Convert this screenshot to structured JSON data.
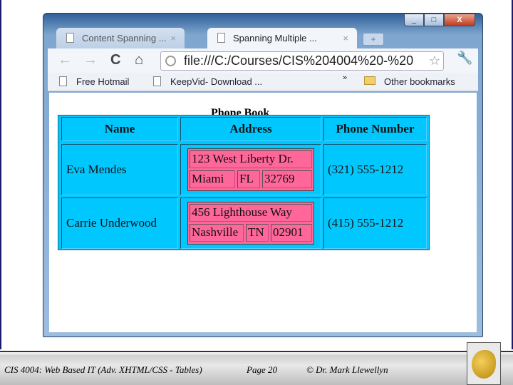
{
  "browser": {
    "tabs": [
      {
        "label": "Content Spanning ..."
      },
      {
        "label": "Spanning Multiple ..."
      }
    ],
    "address": "file:///C:/Courses/CIS%204004%20-%20",
    "bookmarks": [
      "Free Hotmail",
      "KeepVid- Download ..."
    ],
    "overflow": "»",
    "other_bookmarks": "Other bookmarks"
  },
  "table": {
    "caption": "Phone Book",
    "headers": [
      "Name",
      "Address",
      "Phone Number"
    ],
    "rows": [
      {
        "name": "Eva Mendes",
        "street": "123 West Liberty Dr.",
        "city": "Miami",
        "state": "FL",
        "zip": "32769",
        "phone": "(321) 555-1212"
      },
      {
        "name": "Carrie Underwood",
        "street": "456 Lighthouse Way",
        "city": "Nashville",
        "state": "TN",
        "zip": "02901",
        "phone": "(415) 555-1212"
      }
    ],
    "colors": {
      "table_bg": "#00c8ff",
      "address_bg": "#ff6699"
    }
  },
  "footer": {
    "course": "CIS 4004: Web Based IT (Adv. XHTML/CSS - Tables)",
    "page": "Page 20",
    "author": "© Dr. Mark Llewellyn"
  }
}
